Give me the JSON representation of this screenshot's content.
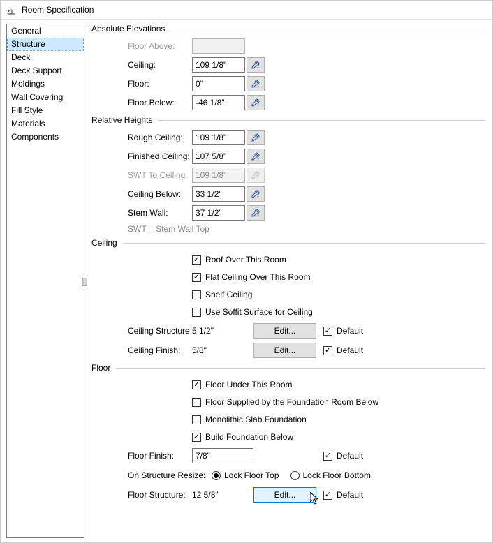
{
  "window": {
    "title": "Room Specification"
  },
  "sidebar": {
    "items": [
      {
        "label": "General"
      },
      {
        "label": "Structure",
        "selected": true
      },
      {
        "label": "Deck"
      },
      {
        "label": "Deck Support"
      },
      {
        "label": "Moldings"
      },
      {
        "label": "Wall Covering"
      },
      {
        "label": "Fill Style"
      },
      {
        "label": "Materials"
      },
      {
        "label": "Components"
      }
    ]
  },
  "groups": {
    "absolute": {
      "title": "Absolute Elevations",
      "floor_above_label": "Floor Above:",
      "floor_above_value": "",
      "ceiling_label": "Ceiling:",
      "ceiling_value": "109 1/8\"",
      "floor_label": "Floor:",
      "floor_value": "0\"",
      "floor_below_label": "Floor Below:",
      "floor_below_value": "-46 1/8\""
    },
    "relative": {
      "title": "Relative Heights",
      "rough_ceiling_label": "Rough Ceiling:",
      "rough_ceiling_value": "109 1/8\"",
      "finished_ceiling_label": "Finished Ceiling:",
      "finished_ceiling_value": "107 5/8\"",
      "swt_to_ceiling_label": "SWT To Ceiling:",
      "swt_to_ceiling_value": "109 1/8\"",
      "ceiling_below_label": "Ceiling Below:",
      "ceiling_below_value": "33 1/2\"",
      "stem_wall_label": "Stem Wall:",
      "stem_wall_value": "37 1/2\"",
      "swt_note": "SWT = Stem Wall Top"
    },
    "ceiling": {
      "title": "Ceiling",
      "roof_over": "Roof Over This Room",
      "flat_ceiling": "Flat Ceiling Over This Room",
      "shelf_ceiling": "Shelf Ceiling",
      "use_soffit": "Use Soffit Surface for Ceiling",
      "structure_label": "Ceiling Structure:",
      "structure_value": "5 1/2\"",
      "finish_label": "Ceiling Finish:",
      "finish_value": "5/8\"",
      "edit_label": "Edit...",
      "default_label": "Default"
    },
    "floor": {
      "title": "Floor",
      "floor_under": "Floor Under This Room",
      "floor_supplied": "Floor Supplied by the Foundation Room Below",
      "monolithic": "Monolithic Slab Foundation",
      "build_foundation": "Build Foundation Below",
      "floor_finish_label": "Floor Finish:",
      "floor_finish_value": "7/8\"",
      "on_resize_label": "On Structure Resize:",
      "lock_top": "Lock Floor Top",
      "lock_bottom": "Lock Floor Bottom",
      "floor_structure_label": "Floor Structure:",
      "floor_structure_value": "12 5/8\"",
      "edit_label": "Edit...",
      "default_label": "Default"
    }
  }
}
